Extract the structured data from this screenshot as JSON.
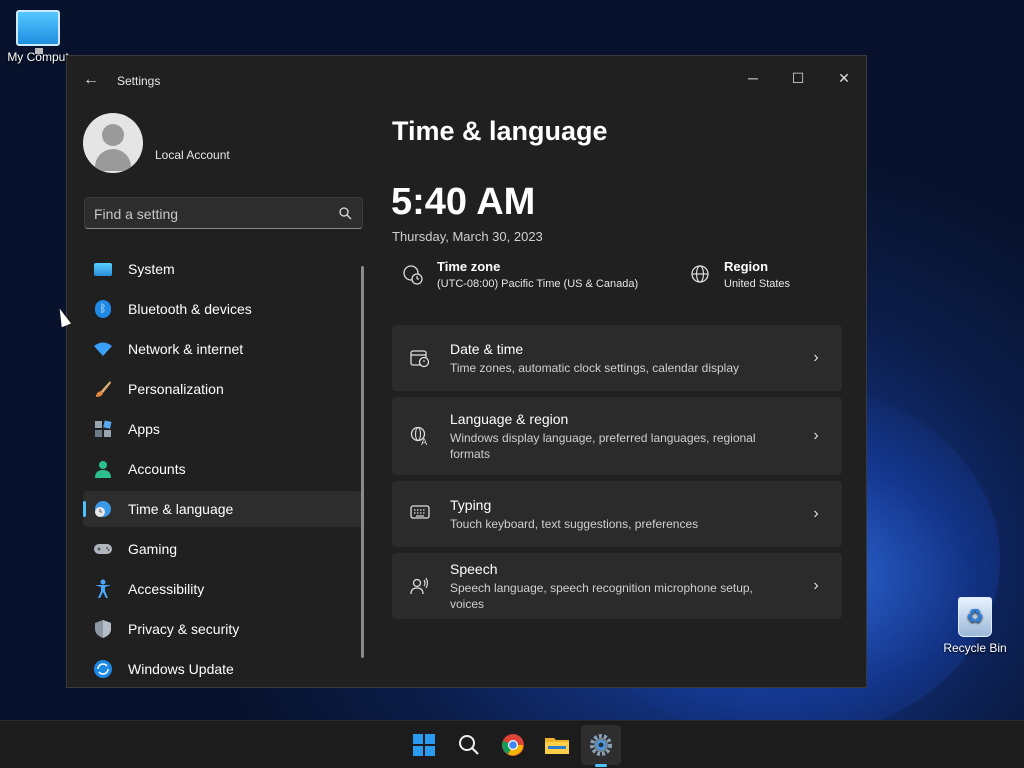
{
  "desktop": {
    "icons": [
      {
        "label": "My Comput",
        "icon": "monitor-icon"
      },
      {
        "label": "Recycle Bin",
        "icon": "recycle-bin-icon"
      }
    ]
  },
  "window": {
    "title": "Settings",
    "controls": {
      "minimize": "─",
      "maximize": "☐",
      "close": "✕"
    },
    "back_glyph": "←"
  },
  "sidebar": {
    "account_name": "Local Account",
    "search_placeholder": "Find a setting",
    "items": [
      {
        "label": "System",
        "icon": "system-icon",
        "active": false
      },
      {
        "label": "Bluetooth & devices",
        "icon": "bluetooth-icon",
        "active": false
      },
      {
        "label": "Network & internet",
        "icon": "wifi-icon",
        "active": false
      },
      {
        "label": "Personalization",
        "icon": "brush-icon",
        "active": false
      },
      {
        "label": "Apps",
        "icon": "apps-icon",
        "active": false
      },
      {
        "label": "Accounts",
        "icon": "accounts-icon",
        "active": false
      },
      {
        "label": "Time & language",
        "icon": "time-language-icon",
        "active": true
      },
      {
        "label": "Gaming",
        "icon": "gamepad-icon",
        "active": false
      },
      {
        "label": "Accessibility",
        "icon": "accessibility-icon",
        "active": false
      },
      {
        "label": "Privacy & security",
        "icon": "shield-icon",
        "active": false
      },
      {
        "label": "Windows Update",
        "icon": "update-icon",
        "active": false
      }
    ]
  },
  "main": {
    "page_title": "Time & language",
    "time": "5:40 AM",
    "date": "Thursday, March 30, 2023",
    "time_zone": {
      "title": "Time zone",
      "value": "(UTC-08:00) Pacific Time (US & Canada)"
    },
    "region": {
      "title": "Region",
      "value": "United States"
    },
    "cards": [
      {
        "title": "Date & time",
        "desc": "Time zones, automatic clock settings, calendar display",
        "icon": "calendar-clock-icon"
      },
      {
        "title": "Language & region",
        "desc": "Windows display language, preferred languages, regional formats",
        "icon": "language-icon"
      },
      {
        "title": "Typing",
        "desc": "Touch keyboard, text suggestions, preferences",
        "icon": "keyboard-icon"
      },
      {
        "title": "Speech",
        "desc": "Speech language, speech recognition microphone setup, voices",
        "icon": "speech-icon"
      }
    ]
  },
  "taskbar": {
    "icons": [
      "start-icon",
      "search-icon",
      "chrome-icon",
      "file-explorer-icon",
      "settings-icon"
    ],
    "active": "settings-icon"
  },
  "colors": {
    "accent": "#4cc2ff",
    "window_bg": "#202020",
    "card_bg": "#2b2b2b"
  }
}
